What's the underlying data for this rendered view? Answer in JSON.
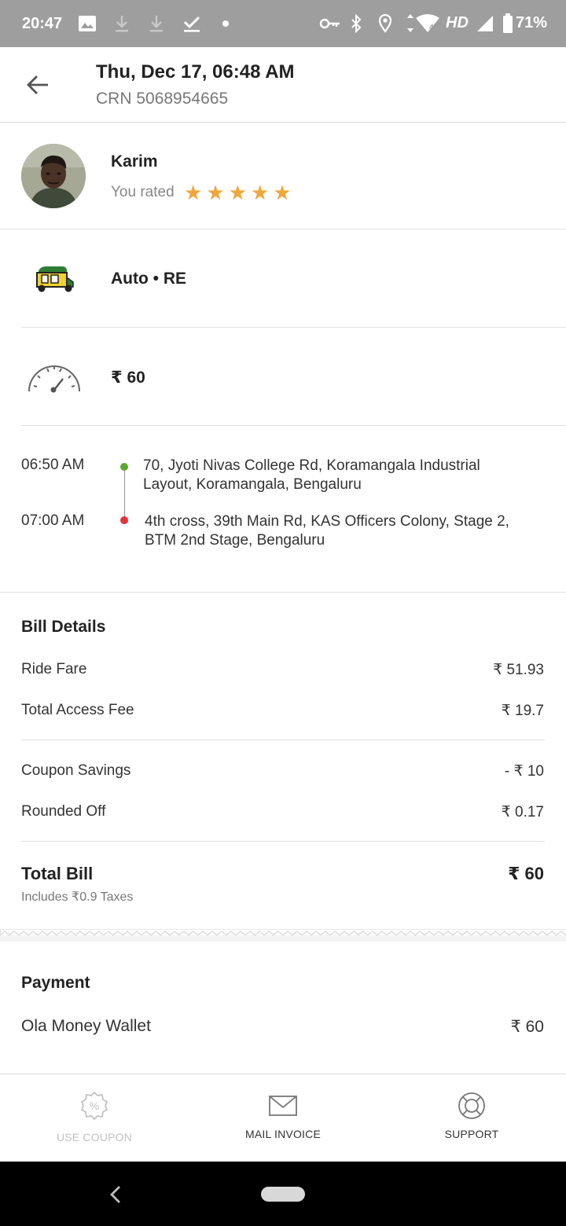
{
  "status_bar": {
    "time": "20:47",
    "network_label": "HD",
    "battery": "71%",
    "icons": [
      "image-icon",
      "download-icon",
      "download-icon",
      "check-icon",
      "dot-icon",
      "vpn-key-icon",
      "bluetooth-icon",
      "location-icon",
      "wifi-icon",
      "signal-icon",
      "battery-icon"
    ]
  },
  "header": {
    "title": "Thu, Dec 17, 06:48 AM",
    "crn": "CRN 5068954665"
  },
  "driver": {
    "name": "Karim",
    "rated_label": "You rated",
    "rating": 5,
    "stars": [
      "★",
      "★",
      "★",
      "★",
      "★"
    ]
  },
  "vehicle": {
    "label": "Auto • RE",
    "icon": "auto-rickshaw-icon"
  },
  "fare": {
    "label": "₹ 60",
    "icon": "speedometer-icon"
  },
  "trip": {
    "pickup": {
      "time": "06:50 AM",
      "address": "70, Jyoti Nivas College Rd, Koramangala Industrial Layout, Koramangala, Bengaluru"
    },
    "drop": {
      "time": "07:00 AM",
      "address": "4th cross, 39th Main Rd, KAS Officers Colony, Stage 2, BTM 2nd Stage, Bengaluru"
    }
  },
  "bill": {
    "title": "Bill Details",
    "items": [
      {
        "label": "Ride Fare",
        "value": "₹ 51.93"
      },
      {
        "label": "Total Access Fee",
        "value": "₹ 19.7"
      },
      {
        "label": "Coupon Savings",
        "value": "- ₹ 10"
      },
      {
        "label": "Rounded Off",
        "value": "₹ 0.17"
      }
    ],
    "total_label": "Total Bill",
    "total_value": "₹ 60",
    "taxes_note": "Includes ₹0.9 Taxes"
  },
  "payment": {
    "title": "Payment",
    "method": "Ola Money Wallet",
    "amount": "₹ 60"
  },
  "actions": {
    "use_coupon": "USE COUPON",
    "mail_invoice": "MAIL INVOICE",
    "support": "SUPPORT"
  },
  "colors": {
    "star": "#f0a63a",
    "pickup_dot": "#5aa832",
    "drop_dot": "#e8303c",
    "disabled_action": "#c2c2c2",
    "status_bar_bg": "#9e9e9e"
  }
}
